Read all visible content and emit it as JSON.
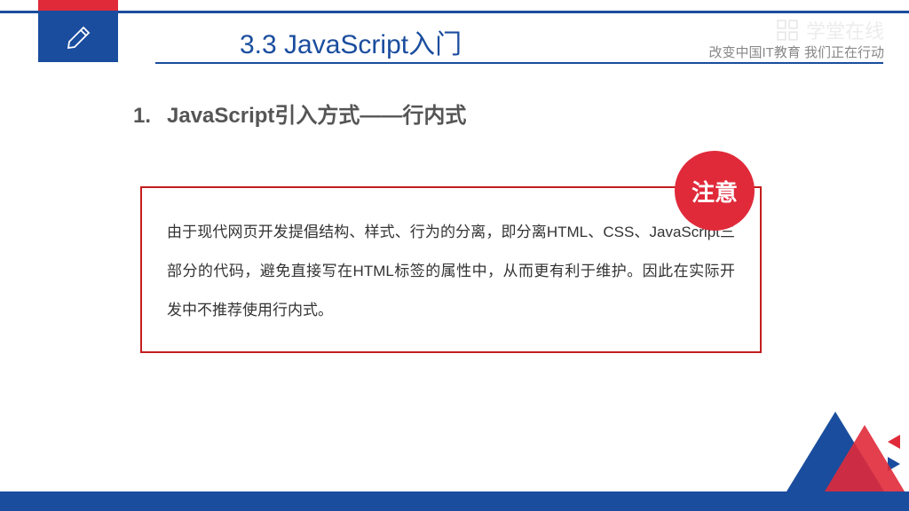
{
  "header": {
    "section_title": "3.3 JavaScript入门",
    "tagline": "改变中国IT教育 我们正在行动",
    "watermark": "学堂在线"
  },
  "content": {
    "list_number": "1.",
    "list_heading": "JavaScript引入方式——行内式",
    "note_badge": "注意",
    "note_text": "由于现代网页开发提倡结构、样式、行为的分离，即分离HTML、CSS、JavaScript三部分的代码，避免直接写在HTML标签的属性中，从而更有利于维护。因此在实际开发中不推荐使用行内式。"
  }
}
